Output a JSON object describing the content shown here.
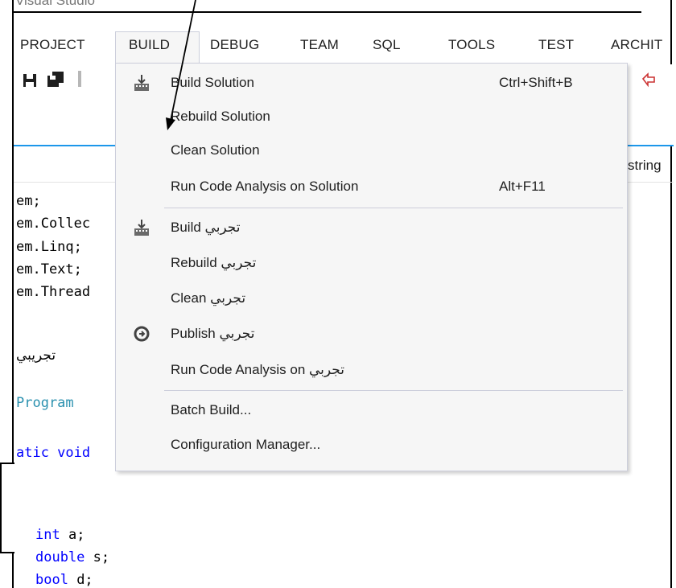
{
  "window": {
    "title": "Visual Studio"
  },
  "menubar": {
    "items": [
      "PROJECT",
      "BUILD",
      "DEBUG",
      "TEAM",
      "SQL",
      "TOOLS",
      "TEST",
      "ARCHIT"
    ]
  },
  "editor": {
    "tab_label": "string",
    "code_lines": [
      "em;",
      "em.Collec",
      "em.Linq;",
      "em.Text;",
      "em.Thread",
      "تجريبي",
      "Program",
      "atic void",
      "int a;",
      "double s;",
      "bool d;"
    ]
  },
  "build_menu": {
    "items": [
      {
        "label": "Build Solution",
        "shortcut": "Ctrl+Shift+B",
        "icon": "build-icon"
      },
      {
        "label": "Rebuild Solution",
        "shortcut": ""
      },
      {
        "label": "Clean Solution",
        "shortcut": ""
      },
      {
        "label": "Run Code Analysis on Solution",
        "shortcut": "Alt+F11"
      },
      {
        "label": "Build تجربي",
        "shortcut": "",
        "icon": "build-icon"
      },
      {
        "label": "Rebuild تجربي",
        "shortcut": ""
      },
      {
        "label": "Clean تجربي",
        "shortcut": ""
      },
      {
        "label": "Publish تجربي",
        "shortcut": "",
        "icon": "publish-icon"
      },
      {
        "label": "Run Code Analysis on تجربي",
        "shortcut": ""
      },
      {
        "label": "Batch Build...",
        "shortcut": ""
      },
      {
        "label": "Configuration Manager...",
        "shortcut": ""
      }
    ]
  },
  "colors": {
    "accent": "#1c97ea",
    "menu_bg": "#f6f6f6",
    "menu_border": "#cccedb"
  }
}
